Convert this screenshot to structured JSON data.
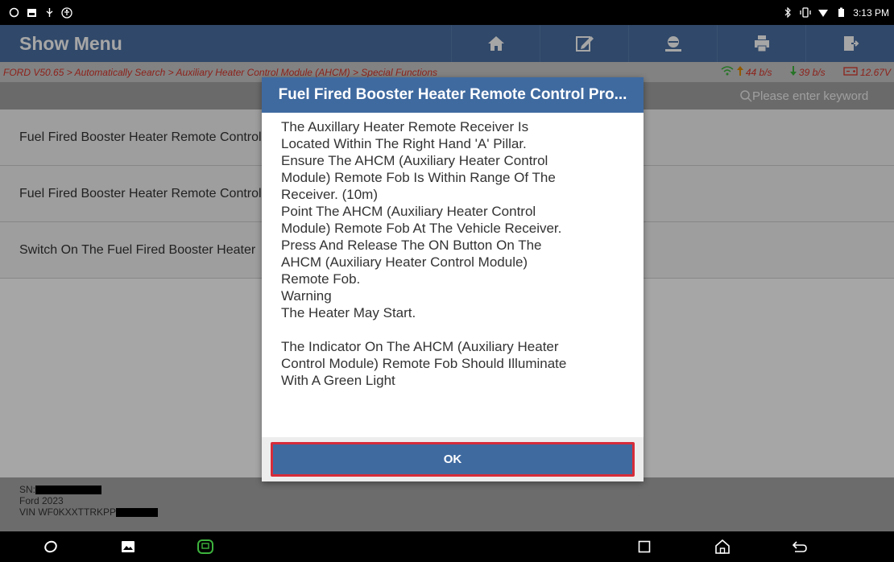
{
  "status_bar": {
    "time": "3:13 PM",
    "left_icons": [
      "message-icon",
      "image-icon",
      "usb-icon",
      "accessibility-icon"
    ],
    "right_icons": [
      "bluetooth-icon",
      "vibrate-icon",
      "wifi-icon",
      "battery-icon"
    ]
  },
  "header": {
    "title": "Show Menu",
    "buttons": [
      "home-icon",
      "edit-icon",
      "vehicle-icon",
      "print-icon",
      "exit-icon"
    ]
  },
  "breadcrumb": {
    "text": "FORD V50.65 > Automatically Search > Auxiliary Heater Control Module (AHCM) > Special Functions",
    "upload": "44 b/s",
    "download": "39 b/s",
    "voltage": "12.67V"
  },
  "search": {
    "placeholder": "Please enter keyword"
  },
  "list": {
    "items": [
      "Fuel Fired Booster Heater Remote Control Programming",
      "Fuel Fired Booster Heater Remote Control Reset",
      "Switch On The Fuel Fired Booster Heater"
    ]
  },
  "footer": {
    "sn_label": "SN:",
    "vehicle": "Ford  2023",
    "vin_label": "VIN WF0KXXTTRKPP"
  },
  "dialog": {
    "title": "Fuel Fired Booster Heater Remote Control Pro...",
    "body": "The Auxillary Heater Remote Receiver Is\nLocated Within The Right Hand 'A' Pillar.\nEnsure The AHCM (Auxiliary Heater Control\nModule) Remote Fob Is Within Range Of The\nReceiver. (10m)\nPoint The AHCM (Auxiliary Heater Control\nModule) Remote Fob At The Vehicle Receiver.\nPress And Release The ON Button On The\nAHCM (Auxiliary Heater Control Module)\nRemote Fob.\nWarning\nThe Heater May Start.\n\nThe Indicator On The AHCM (Auxiliary Heater\nControl Module) Remote Fob Should Illuminate\nWith A Green Light",
    "ok_label": "OK"
  },
  "colors": {
    "accent": "#4a6fa1",
    "dialog_header": "#3f6aa0",
    "ok_border": "#d62c3a",
    "breadcrumb_text": "#d9352a"
  }
}
